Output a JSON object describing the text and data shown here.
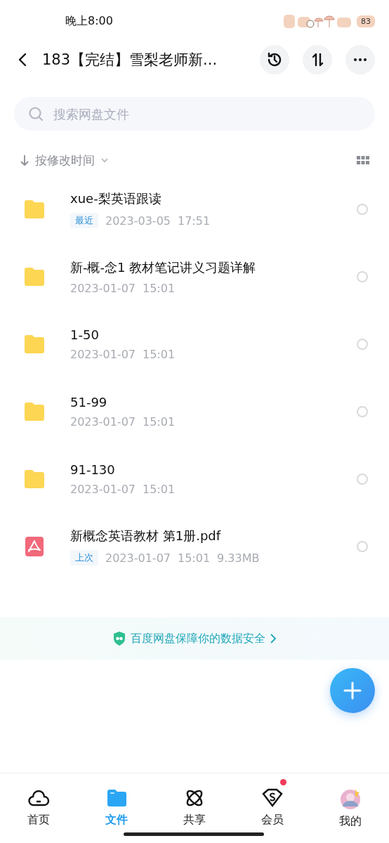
{
  "status_bar": {
    "time": "晚上8:00",
    "battery": "83"
  },
  "header": {
    "title": "183【完结】雪梨老师新..."
  },
  "search": {
    "placeholder": "搜索网盘文件"
  },
  "sort": {
    "label": "按修改时间"
  },
  "files": [
    {
      "kind": "folder",
      "name": "xue-梨英语跟读",
      "tag": "最近",
      "date": "2023-03-05",
      "time": "17:51",
      "selected": false
    },
    {
      "kind": "folder",
      "name": "新-概-念1 教材笔记讲义习题详解",
      "date": "2023-01-07",
      "time": "15:01",
      "selected": false
    },
    {
      "kind": "folder",
      "name": "1-50",
      "date": "2023-01-07",
      "time": "15:01",
      "selected": false
    },
    {
      "kind": "folder",
      "name": "51-99",
      "date": "2023-01-07",
      "time": "15:01",
      "selected": false
    },
    {
      "kind": "folder",
      "name": "91-130",
      "date": "2023-01-07",
      "time": "15:01",
      "selected": false
    },
    {
      "kind": "pdf",
      "name": "新概念英语教材 第1册.pdf",
      "tag": "上次",
      "date": "2023-01-07",
      "time": "15:01",
      "size": "9.33MB",
      "selected": false
    }
  ],
  "banner": {
    "text": "百度网盘保障你的数据安全"
  },
  "tabs": [
    {
      "kind": "home",
      "label": "首页",
      "selected": false,
      "badge": false
    },
    {
      "kind": "files",
      "label": "文件",
      "selected": true,
      "badge": false
    },
    {
      "kind": "share",
      "label": "共享",
      "selected": false,
      "badge": false
    },
    {
      "kind": "vip",
      "label": "会员",
      "selected": false,
      "badge": true
    },
    {
      "kind": "me",
      "label": "我的",
      "selected": false,
      "badge": false
    }
  ]
}
